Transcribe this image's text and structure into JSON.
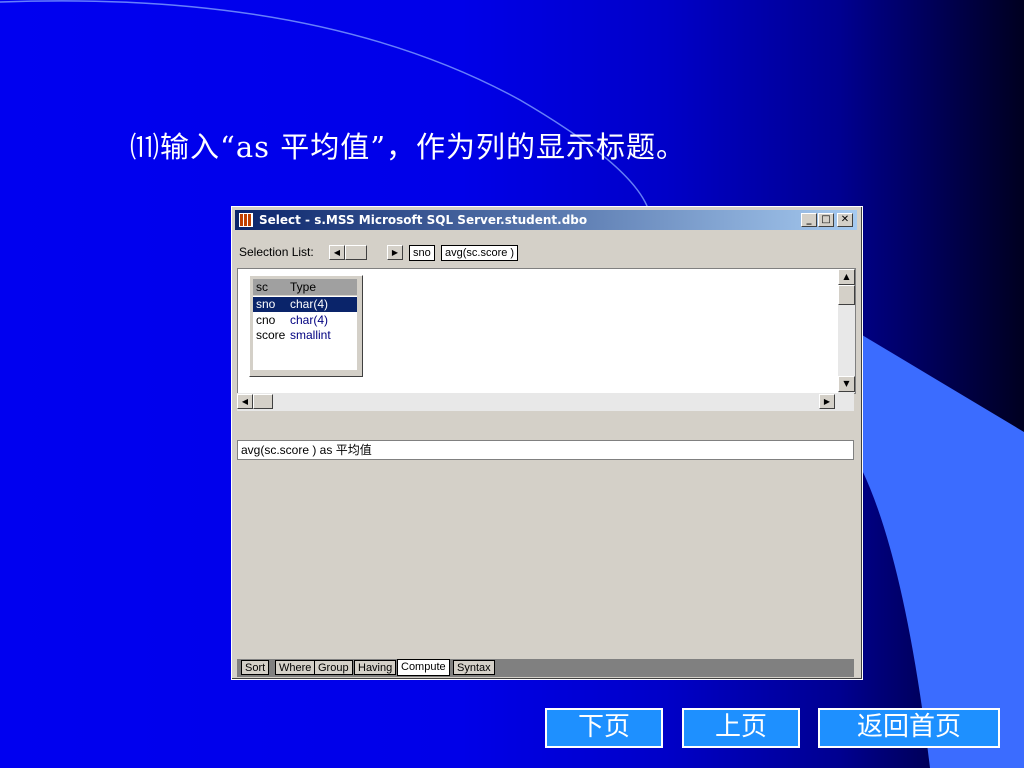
{
  "slide": {
    "title": "⑾输入“as 平均值”，作为列的显示标题。"
  },
  "window": {
    "title": "Select - s.MSS Microsoft SQL Server.student.dbo",
    "minimize": "_",
    "maximize": "□",
    "close": "✕"
  },
  "selection_list": {
    "label": "Selection List:",
    "items": [
      "sno",
      "avg(sc.score )"
    ]
  },
  "table": {
    "name": "sc",
    "type_header": "Type",
    "rows": [
      {
        "col": "sno",
        "type": "char(4)",
        "selected": true
      },
      {
        "col": "cno",
        "type": "char(4)",
        "selected": false
      },
      {
        "col": "score",
        "type": "smallint",
        "selected": false
      }
    ]
  },
  "expression": {
    "value": "avg(sc.score ) as 平均值"
  },
  "tabs": [
    "Sort",
    "Where",
    "Group",
    "Having",
    "Compute",
    "Syntax"
  ],
  "active_tab": "Compute",
  "nav": {
    "next": "下页",
    "prev": "上页",
    "home": "返回首页"
  },
  "colors": {
    "nav_button": "#1e90ff",
    "titlebar_start": "#0a246a",
    "selected_row": "#0a246a"
  }
}
